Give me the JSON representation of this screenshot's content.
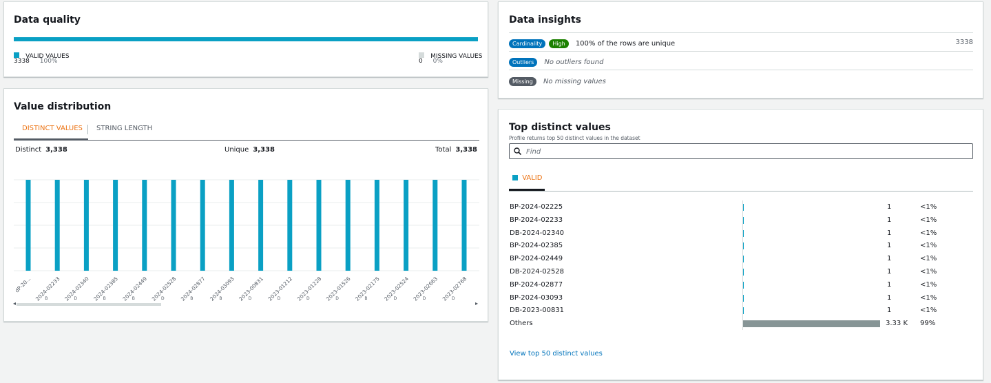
{
  "data_quality": {
    "title": "Data quality",
    "valid": {
      "label": "VALID VALUES",
      "count": "3338",
      "pct": "100%",
      "color": "#0aa0c4"
    },
    "missing": {
      "label": "MISSING VALUES",
      "count": "0",
      "pct": "0%",
      "color": "#d5dbdb"
    }
  },
  "value_distribution": {
    "title": "Value distribution",
    "tabs": [
      "DISTINCT VALUES",
      "STRING LENGTH"
    ],
    "active_tab": "DISTINCT VALUES",
    "stats": {
      "distinct_label": "Distinct",
      "distinct": "3,338",
      "unique_label": "Unique",
      "unique": "3,338",
      "total_label": "Total",
      "total": "3,338"
    }
  },
  "chart_data": {
    "type": "bar",
    "categories": [
      "BP-20...",
      "BP-2024-02233",
      "DB-2024-02340",
      "BP-2024-02385",
      "BP-2024-02449",
      "DB-2024-02528",
      "BP-2024-02877",
      "BP-2024-03093",
      "DB-2023-00831",
      "DB-2023-01212",
      "DB-2023-01228",
      "DB-2023-01526",
      "BP-2023-02175",
      "DB-2023-02524",
      "DB-2023-02663",
      "DB-2023-02768"
    ],
    "tick_labels": [
      "dP-20...",
      "2024-02233",
      "2024-02340",
      "2024-02385",
      "2024-02449",
      "2024-02528",
      "2024-02877",
      "2024-03093",
      "2023-00831",
      "2023-01212",
      "2023-01228",
      "2023-01526",
      "2023-02175",
      "2023-02524",
      "2023-02663",
      "2023-02768"
    ],
    "tick_prefixes": [
      "",
      "B",
      "D",
      "B",
      "B",
      "D",
      "B",
      "B",
      "D",
      "D",
      "D",
      "D",
      "B",
      "D",
      "D",
      "D"
    ],
    "values": [
      1,
      1,
      1,
      1,
      1,
      1,
      1,
      1,
      1,
      1,
      1,
      1,
      1,
      1,
      1,
      1
    ],
    "ylim": [
      0,
      1
    ],
    "grid": true,
    "bar_color": "#0aa0c4"
  },
  "data_insights": {
    "title": "Data insights",
    "rows": [
      {
        "badges": [
          {
            "text": "Cardinality",
            "color": "#0073bb"
          },
          {
            "text": "High",
            "color": "#1d8102"
          }
        ],
        "text": "100% of the rows are unique",
        "value": "3338",
        "italic": false
      },
      {
        "badges": [
          {
            "text": "Outliers",
            "color": "#0073bb"
          }
        ],
        "text": "No outliers found",
        "value": "",
        "italic": true
      },
      {
        "badges": [
          {
            "text": "Missing",
            "color": "#545b64"
          }
        ],
        "text": "No missing values",
        "value": "",
        "italic": true
      }
    ]
  },
  "top_distinct": {
    "title": "Top distinct values",
    "subtitle": "Profile returns top 50 distinct values in the dataset",
    "search_placeholder": "Find",
    "tab_label": "VALID",
    "rows": [
      {
        "name": "BP-2024-02225",
        "count": "1",
        "pct": "<1%",
        "share": 0.003
      },
      {
        "name": "BP-2024-02233",
        "count": "1",
        "pct": "<1%",
        "share": 0.003
      },
      {
        "name": "DB-2024-02340",
        "count": "1",
        "pct": "<1%",
        "share": 0.003
      },
      {
        "name": "BP-2024-02385",
        "count": "1",
        "pct": "<1%",
        "share": 0.003
      },
      {
        "name": "BP-2024-02449",
        "count": "1",
        "pct": "<1%",
        "share": 0.003
      },
      {
        "name": "DB-2024-02528",
        "count": "1",
        "pct": "<1%",
        "share": 0.003
      },
      {
        "name": "BP-2024-02877",
        "count": "1",
        "pct": "<1%",
        "share": 0.003
      },
      {
        "name": "BP-2024-03093",
        "count": "1",
        "pct": "<1%",
        "share": 0.003
      },
      {
        "name": "DB-2023-00831",
        "count": "1",
        "pct": "<1%",
        "share": 0.003
      }
    ],
    "others": {
      "name": "Others",
      "count": "3.33 K",
      "pct": "99%",
      "share": 0.99
    },
    "link": "View top 50 distinct values"
  }
}
